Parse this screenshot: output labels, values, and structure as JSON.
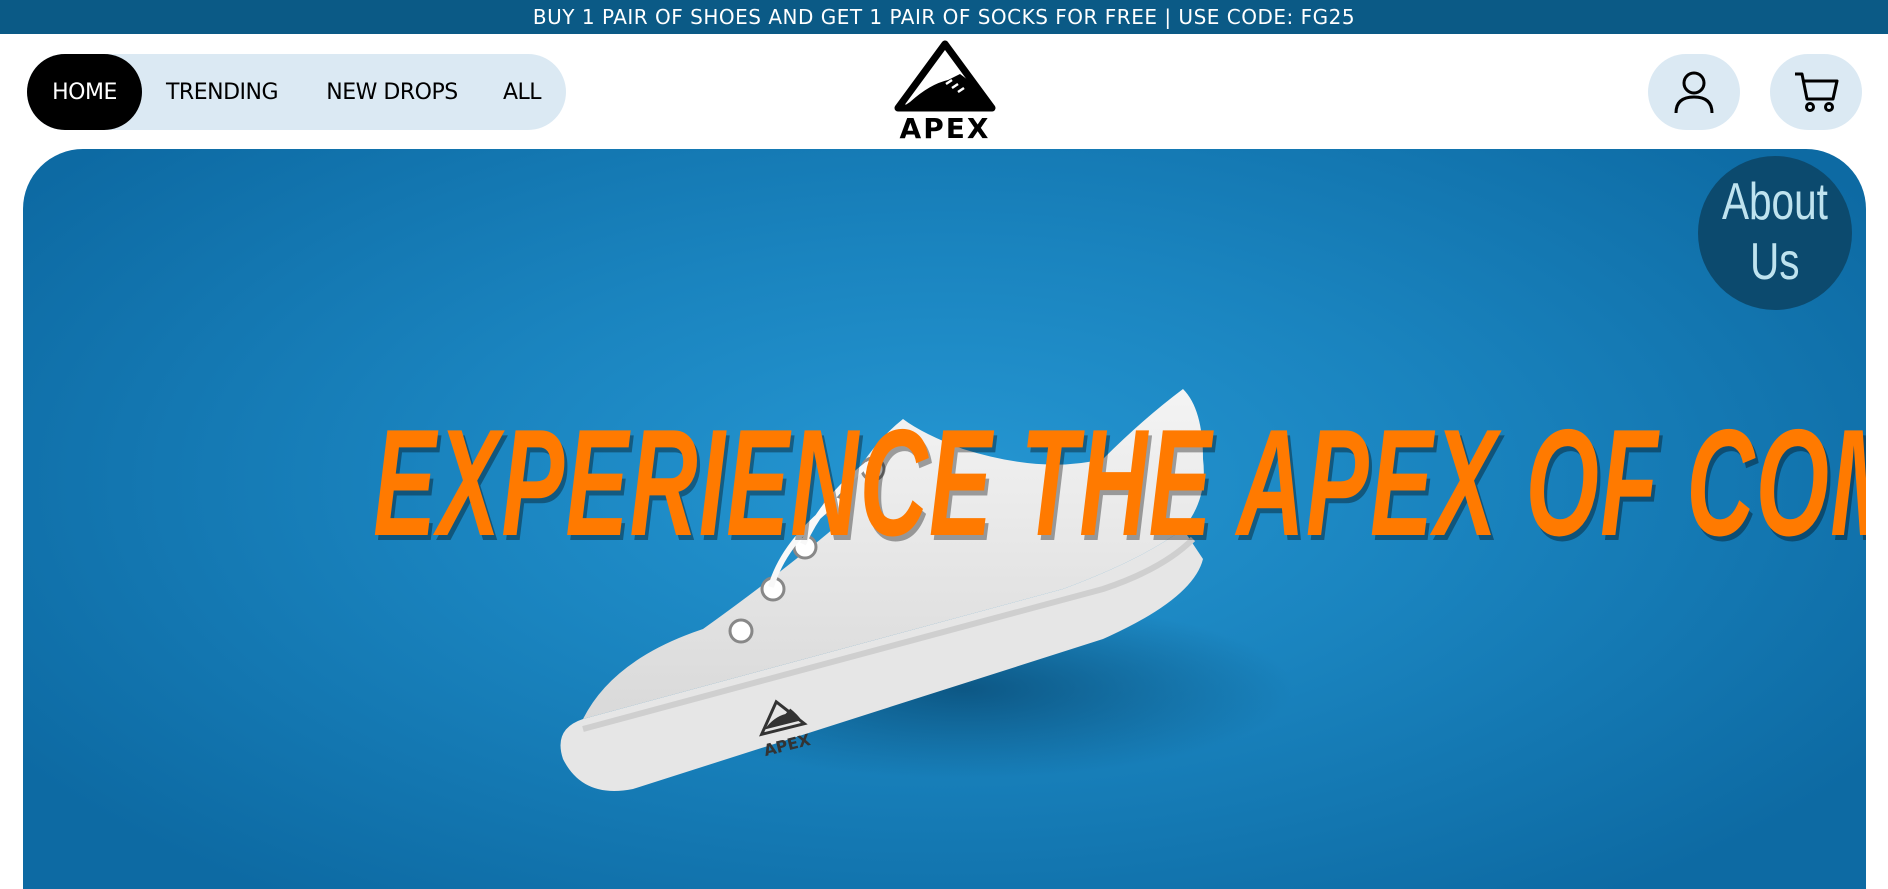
{
  "announcement": {
    "text": "BUY 1 PAIR OF SHOES AND GET 1 PAIR OF SOCKS FOR FREE | USE CODE: FG25"
  },
  "nav": {
    "items": [
      {
        "label": "HOME",
        "active": true
      },
      {
        "label": "TRENDING",
        "active": false
      },
      {
        "label": "NEW DROPS",
        "active": false
      },
      {
        "label": "ALL",
        "active": false
      }
    ]
  },
  "logo": {
    "text": "APEX"
  },
  "header_actions": {
    "account_icon": "user-icon",
    "cart_icon": "cart-icon"
  },
  "hero": {
    "headline": "EXPERIENCE THE APEX OF COMFORT AND STYLE",
    "about_line1": "About",
    "about_line2": "Us",
    "shoe_logo_text": "APEX"
  },
  "colors": {
    "announcement_bg": "#0b5a86",
    "nav_pill_bg": "#dbe9f3",
    "active_bg": "#000000",
    "hero_blue": "#1a84bf",
    "headline_orange": "#ff7a00",
    "about_bg": "#0c4a6e",
    "about_text": "#bfe3ef"
  }
}
